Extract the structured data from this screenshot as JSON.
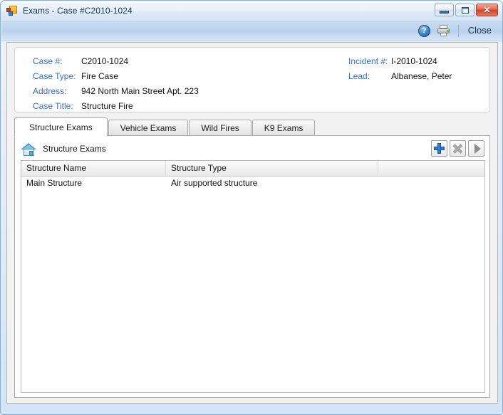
{
  "window": {
    "title": "Exams - Case #C2010-1024",
    "app_icon": "app-window-icon",
    "controls": {
      "minimize": "minimize-button",
      "maximize": "maximize-button",
      "close": "✕"
    }
  },
  "toolbar": {
    "help_icon": "?",
    "print_icon": "printer-icon",
    "close_label": "Close"
  },
  "case_info": {
    "left": [
      {
        "label": "Case #:",
        "value": "C2010-1024"
      },
      {
        "label": "Case Type:",
        "value": "Fire Case"
      },
      {
        "label": "Address:",
        "value": "942 North Main Street Apt. 223"
      },
      {
        "label": "Case Title:",
        "value": "Structure Fire"
      }
    ],
    "right": [
      {
        "label": "Incident #:",
        "value": "I-2010-1024"
      },
      {
        "label": "Lead:",
        "value": "Albanese, Peter"
      }
    ]
  },
  "tabs": [
    {
      "label": "Structure Exams",
      "active": true
    },
    {
      "label": "Vehicle Exams",
      "active": false
    },
    {
      "label": "Wild Fires",
      "active": false
    },
    {
      "label": "K9 Exams",
      "active": false
    }
  ],
  "section": {
    "icon": "house-icon",
    "title": "Structure Exams"
  },
  "actions": [
    {
      "name": "add-button",
      "glyph": "plus",
      "enabled": true
    },
    {
      "name": "delete-button",
      "glyph": "x",
      "enabled": false
    },
    {
      "name": "open-button",
      "glyph": "chevron-right",
      "enabled": true
    }
  ],
  "grid": {
    "columns": [
      "Structure Name",
      "Structure Type",
      ""
    ],
    "rows": [
      [
        "Main Structure",
        "Air supported structure",
        ""
      ]
    ]
  },
  "colors": {
    "label_blue": "#3a6fb5",
    "accent_blue": "#2f7fd1",
    "close_red": "#cf432c",
    "frame_blue": "#8aaed6"
  }
}
